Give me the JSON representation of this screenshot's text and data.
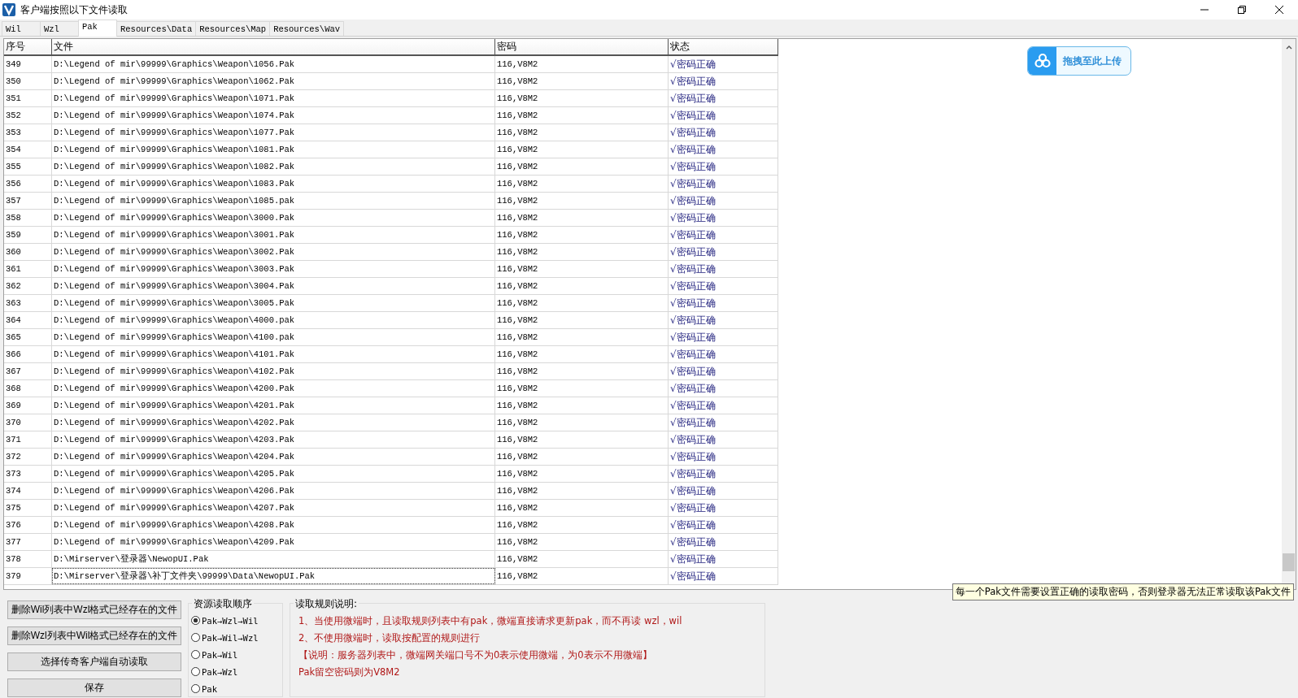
{
  "window": {
    "title": "客户端按照以下文件读取"
  },
  "tabs": [
    {
      "label": "Wil",
      "selected": false
    },
    {
      "label": "Wzl",
      "selected": false
    },
    {
      "label": "Pak",
      "selected": true
    },
    {
      "label": "Resources\\Data",
      "selected": false
    },
    {
      "label": "Resources\\Map",
      "selected": false
    },
    {
      "label": "Resources\\Wav",
      "selected": false
    }
  ],
  "table": {
    "columns": [
      "序号",
      "文件",
      "密码",
      "状态"
    ],
    "rows": [
      {
        "index": "349",
        "file": "D:\\Legend of mir\\99999\\Graphics\\Weapon\\1056.Pak",
        "password": "116,V8M2",
        "status": "√密码正确",
        "selected": false
      },
      {
        "index": "350",
        "file": "D:\\Legend of mir\\99999\\Graphics\\Weapon\\1062.Pak",
        "password": "116,V8M2",
        "status": "√密码正确",
        "selected": false
      },
      {
        "index": "351",
        "file": "D:\\Legend of mir\\99999\\Graphics\\Weapon\\1071.Pak",
        "password": "116,V8M2",
        "status": "√密码正确",
        "selected": false
      },
      {
        "index": "352",
        "file": "D:\\Legend of mir\\99999\\Graphics\\Weapon\\1074.Pak",
        "password": "116,V8M2",
        "status": "√密码正确",
        "selected": false
      },
      {
        "index": "353",
        "file": "D:\\Legend of mir\\99999\\Graphics\\Weapon\\1077.Pak",
        "password": "116,V8M2",
        "status": "√密码正确",
        "selected": false
      },
      {
        "index": "354",
        "file": "D:\\Legend of mir\\99999\\Graphics\\Weapon\\1081.Pak",
        "password": "116,V8M2",
        "status": "√密码正确",
        "selected": false
      },
      {
        "index": "355",
        "file": "D:\\Legend of mir\\99999\\Graphics\\Weapon\\1082.Pak",
        "password": "116,V8M2",
        "status": "√密码正确",
        "selected": false
      },
      {
        "index": "356",
        "file": "D:\\Legend of mir\\99999\\Graphics\\Weapon\\1083.Pak",
        "password": "116,V8M2",
        "status": "√密码正确",
        "selected": false
      },
      {
        "index": "357",
        "file": "D:\\Legend of mir\\99999\\Graphics\\Weapon\\1085.pak",
        "password": "116,V8M2",
        "status": "√密码正确",
        "selected": false
      },
      {
        "index": "358",
        "file": "D:\\Legend of mir\\99999\\Graphics\\Weapon\\3000.Pak",
        "password": "116,V8M2",
        "status": "√密码正确",
        "selected": false
      },
      {
        "index": "359",
        "file": "D:\\Legend of mir\\99999\\Graphics\\Weapon\\3001.Pak",
        "password": "116,V8M2",
        "status": "√密码正确",
        "selected": false
      },
      {
        "index": "360",
        "file": "D:\\Legend of mir\\99999\\Graphics\\Weapon\\3002.Pak",
        "password": "116,V8M2",
        "status": "√密码正确",
        "selected": false
      },
      {
        "index": "361",
        "file": "D:\\Legend of mir\\99999\\Graphics\\Weapon\\3003.Pak",
        "password": "116,V8M2",
        "status": "√密码正确",
        "selected": false
      },
      {
        "index": "362",
        "file": "D:\\Legend of mir\\99999\\Graphics\\Weapon\\3004.Pak",
        "password": "116,V8M2",
        "status": "√密码正确",
        "selected": false
      },
      {
        "index": "363",
        "file": "D:\\Legend of mir\\99999\\Graphics\\Weapon\\3005.Pak",
        "password": "116,V8M2",
        "status": "√密码正确",
        "selected": false
      },
      {
        "index": "364",
        "file": "D:\\Legend of mir\\99999\\Graphics\\Weapon\\4000.pak",
        "password": "116,V8M2",
        "status": "√密码正确",
        "selected": false
      },
      {
        "index": "365",
        "file": "D:\\Legend of mir\\99999\\Graphics\\Weapon\\4100.pak",
        "password": "116,V8M2",
        "status": "√密码正确",
        "selected": false
      },
      {
        "index": "366",
        "file": "D:\\Legend of mir\\99999\\Graphics\\Weapon\\4101.Pak",
        "password": "116,V8M2",
        "status": "√密码正确",
        "selected": false
      },
      {
        "index": "367",
        "file": "D:\\Legend of mir\\99999\\Graphics\\Weapon\\4102.Pak",
        "password": "116,V8M2",
        "status": "√密码正确",
        "selected": false
      },
      {
        "index": "368",
        "file": "D:\\Legend of mir\\99999\\Graphics\\Weapon\\4200.Pak",
        "password": "116,V8M2",
        "status": "√密码正确",
        "selected": false
      },
      {
        "index": "369",
        "file": "D:\\Legend of mir\\99999\\Graphics\\Weapon\\4201.Pak",
        "password": "116,V8M2",
        "status": "√密码正确",
        "selected": false
      },
      {
        "index": "370",
        "file": "D:\\Legend of mir\\99999\\Graphics\\Weapon\\4202.Pak",
        "password": "116,V8M2",
        "status": "√密码正确",
        "selected": false
      },
      {
        "index": "371",
        "file": "D:\\Legend of mir\\99999\\Graphics\\Weapon\\4203.Pak",
        "password": "116,V8M2",
        "status": "√密码正确",
        "selected": false
      },
      {
        "index": "372",
        "file": "D:\\Legend of mir\\99999\\Graphics\\Weapon\\4204.Pak",
        "password": "116,V8M2",
        "status": "√密码正确",
        "selected": false
      },
      {
        "index": "373",
        "file": "D:\\Legend of mir\\99999\\Graphics\\Weapon\\4205.Pak",
        "password": "116,V8M2",
        "status": "√密码正确",
        "selected": false
      },
      {
        "index": "374",
        "file": "D:\\Legend of mir\\99999\\Graphics\\Weapon\\4206.Pak",
        "password": "116,V8M2",
        "status": "√密码正确",
        "selected": false
      },
      {
        "index": "375",
        "file": "D:\\Legend of mir\\99999\\Graphics\\Weapon\\4207.Pak",
        "password": "116,V8M2",
        "status": "√密码正确",
        "selected": false
      },
      {
        "index": "376",
        "file": "D:\\Legend of mir\\99999\\Graphics\\Weapon\\4208.Pak",
        "password": "116,V8M2",
        "status": "√密码正确",
        "selected": false
      },
      {
        "index": "377",
        "file": "D:\\Legend of mir\\99999\\Graphics\\Weapon\\4209.Pak",
        "password": "116,V8M2",
        "status": "√密码正确",
        "selected": false
      },
      {
        "index": "378",
        "file": "D:\\Mirserver\\登录器\\NewopUI.Pak",
        "password": "116,V8M2",
        "status": "√密码正确",
        "selected": false
      },
      {
        "index": "379",
        "file": "D:\\Mirserver\\登录器\\补丁文件夹\\99999\\Data\\NewopUI.Pak",
        "password": "116,V8M2",
        "status": "√密码正确",
        "selected": true
      }
    ]
  },
  "upload_button": {
    "label": "拖拽至此上传"
  },
  "tooltip": "每一个Pak文件需要设置正确的读取密码，否则登录器无法正常读取该Pak文件",
  "buttons": [
    "删除Wil列表中Wzl格式已经存在的文件",
    "删除Wzl列表中Wil格式已经存在的文件",
    "选择传奇客户端自动读取",
    "保存"
  ],
  "read_order": {
    "title": "资源读取顺序",
    "options": [
      {
        "label": "Pak→Wzl→Wil",
        "selected": true
      },
      {
        "label": "Pak→Wil→Wzl",
        "selected": false
      },
      {
        "label": "Pak→Wil",
        "selected": false
      },
      {
        "label": "Pak→Wzl",
        "selected": false
      },
      {
        "label": "Pak",
        "selected": false
      }
    ]
  },
  "rules": {
    "title": "读取规则说明:",
    "lines": [
      "1、当使用微端时，且读取规则列表中有pak，微端直接请求更新pak，而不再读 wzl，wil",
      "2、不使用微端时，读取按配置的规则进行",
      "【说明：服务器列表中，微端网关端口号不为0表示使用微端，为0表示不用微端】",
      "Pak留空密码则为V8M2"
    ]
  }
}
